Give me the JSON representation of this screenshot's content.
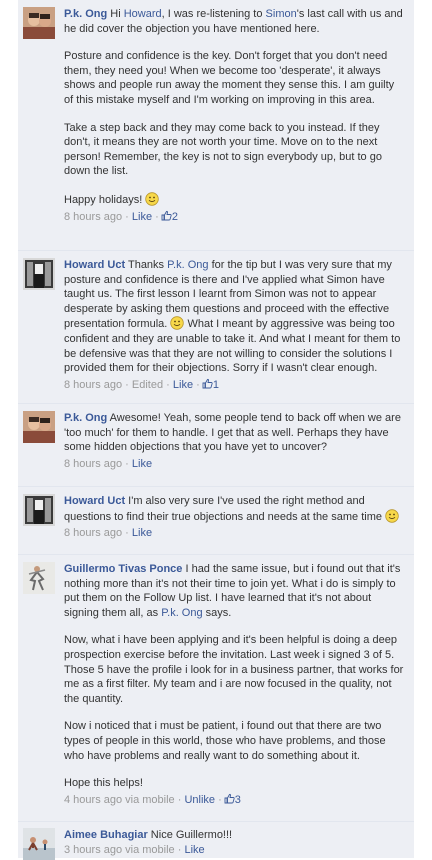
{
  "comments": [
    {
      "author": "P.k. Ong",
      "p1_a": " Hi ",
      "p1_mention1": "Howard",
      "p1_b": ", I was re-listening to ",
      "p1_mention2": "Simon",
      "p1_c": "'s last call with us and he did cover the objection you have mentioned here.",
      "p2": "Posture and confidence is the key. Don't forget that you don't need them, they need you! When we become too 'desperate', it always shows and people run away the moment they sense this. I am guilty of this mistake myself and I'm working on improving in this area.",
      "p3": "Take a step back and they may come back to you instead. If they don't, it means they are not worth your time. Move on to the next person! Remember, the key is not to sign everybody up, but to go down the list.",
      "p4": "Happy holidays! ",
      "time": "8 hours ago",
      "like_label": "Like",
      "likes": "2"
    },
    {
      "author": "Howard Uct",
      "p1_a": " Thanks ",
      "p1_mention1": "P.k. Ong",
      "p1_b": " for the tip but I was very sure that my posture and confidence is there and I've applied what Simon have taught us. The first lesson I learnt from Simon was not to appear desperate by asking them questions and proceed with the effective presentation formula. ",
      "p1_c": " What I meant by aggressive was being too confident and they are unable to take it. And what I meant for them to be defensive was that they are not willing to consider the solutions I provided them for their objections. Sorry if I wasn't clear enough.",
      "time": "8 hours ago",
      "edited": "Edited",
      "like_label": "Like",
      "likes": "1"
    },
    {
      "author": "P.k. Ong",
      "p1": " Awesome! Yeah, some people tend to back off when we are 'too much' for them to handle. I get that as well. Perhaps they have some hidden objections that you have yet to uncover?",
      "time": "8 hours ago",
      "like_label": "Like"
    },
    {
      "author": "Howard Uct",
      "p1": " I'm also very sure I've used the right method and questions to find their true objections and needs at the same time ",
      "time": "8 hours ago",
      "like_label": "Like"
    },
    {
      "author": "Guillermo Tivas Ponce",
      "p1_a": " I had the same issue, but i found out that it's nothing more than it's not their time to join yet. What i do is simply to put them on the Follow Up list. I have learned that it's not about signing them all, as ",
      "p1_mention": "P.k. Ong",
      "p1_b": " says.",
      "p2": "Now, what i have been applying and it's been helpful is doing a deep prospection exercise before the invitation. Last week i signed 3 of 5. Those 5 have the profile i look for in a business partner, that works for me as a first filter. My team and i are now focused in the quality, not the quantity.",
      "p3": "Now i noticed that i must be patient, i found out that there are two types of people in this world, those who have problems, and those who have problems and really want to do something about it.",
      "p4": "Hope this helps!",
      "time": "4 hours ago via mobile",
      "like_label": "Unlike",
      "likes": "3"
    },
    {
      "author": "Aimee Buhagiar",
      "p1": " Nice Guillermo!!!",
      "time": "3 hours ago via mobile",
      "like_label": "Like"
    }
  ],
  "separator": "·",
  "colors": {
    "link": "#3b5998",
    "background": "#edeff4",
    "meta": "#999999",
    "text": "#333333"
  },
  "icons": [
    "smiley-icon",
    "thumbs-up-icon"
  ]
}
